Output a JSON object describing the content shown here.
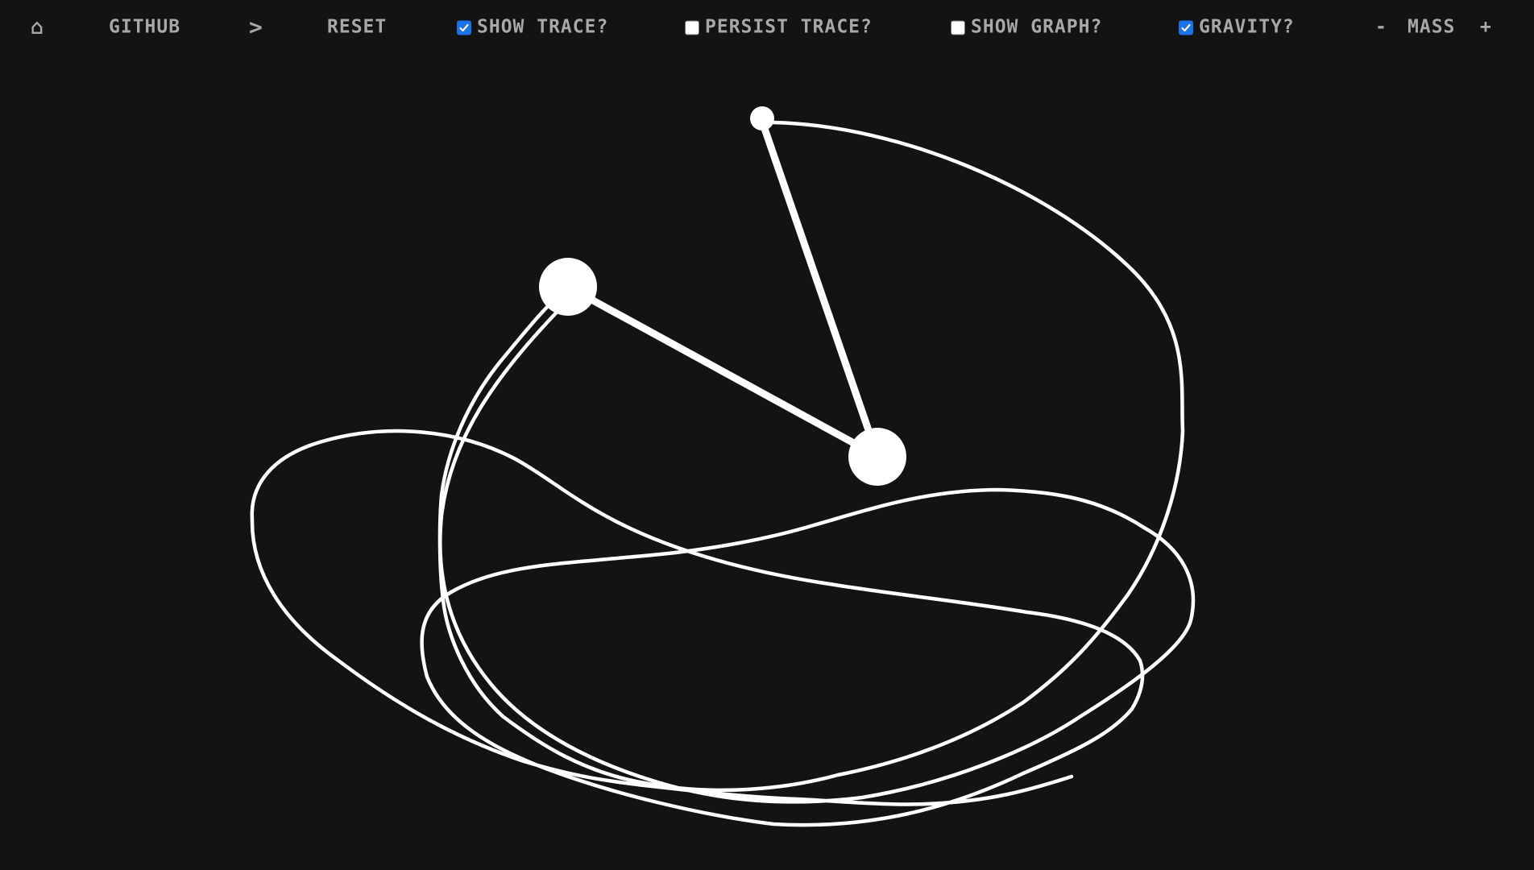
{
  "toolbar": {
    "home_label": "⌂",
    "github_label": "GITHUB",
    "forward_label": ">",
    "reset_label": "RESET",
    "show_trace": {
      "label": "SHOW TRACE?",
      "checked": true
    },
    "persist_trace": {
      "label": "PERSIST TRACE?",
      "checked": false
    },
    "show_graph": {
      "label": "SHOW GRAPH?",
      "checked": false
    },
    "gravity": {
      "label": "GRAVITY?",
      "checked": true
    },
    "mass_minus_label": "-",
    "mass_label": "MASS",
    "mass_plus_label": "+"
  },
  "colors": {
    "background": "#131313",
    "toolbar_text": "#a8a8a8",
    "checkbox_checked": "#1a73e8",
    "pendulum": "#ffffff",
    "trace": "#ffffff"
  }
}
